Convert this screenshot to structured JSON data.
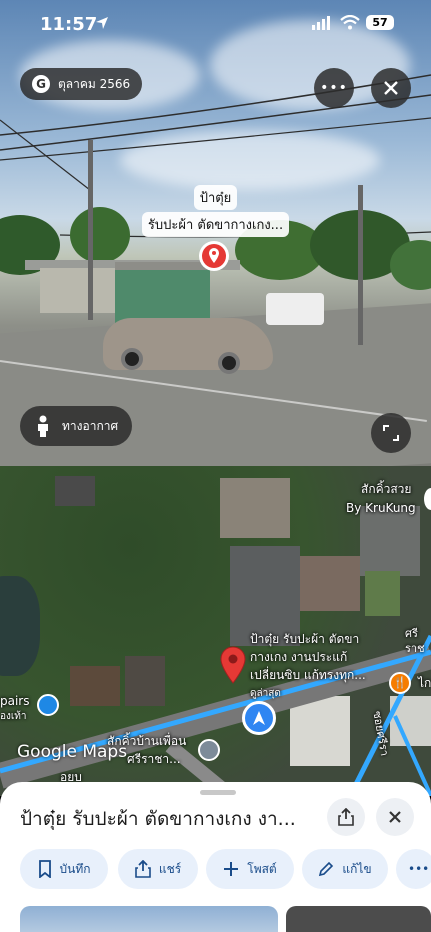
{
  "status_bar": {
    "time": "11:57",
    "battery": "57"
  },
  "street_view": {
    "date_label": "ตุลาคม 2566",
    "place_label_line1": "ป้าตุ๋ย",
    "place_label_line2": "รับปะผ้า ตัดขากางเกง...",
    "aerial_label": "ทางอากาศ"
  },
  "map": {
    "labels": {
      "top_right_1": "สักคิ้วสวย",
      "top_right_2": "By KruKung",
      "place_1": "ป้าตุ๋ย รับปะผ้า ตัดขา",
      "place_2": "กางเกง งานประแก้",
      "place_3": "เปลี่ยนซิบ แก้ทรงทุก...",
      "place_4": "ดูล่าสุด",
      "left_1": "pairs",
      "left_2": "องเท้า",
      "bottom_1": "สักคิ้วบ้านเพื่อน",
      "bottom_2": "ศรีราชา...",
      "road_right": "ศรีราช",
      "road_right_2": "ซอยศรีรา",
      "right_edge": "ไก",
      "road_bottom": "อยบ"
    },
    "google_logo": "Google Maps"
  },
  "sheet": {
    "title": "ป้าตุ๋ย รับปะผ้า ตัดขากางเกง งา...",
    "chips": [
      {
        "label": "บันทึก",
        "icon": "bookmark-icon"
      },
      {
        "label": "แชร์",
        "icon": "share-icon"
      },
      {
        "label": "โพสต์",
        "icon": "plus-icon"
      },
      {
        "label": "แก้ไข",
        "icon": "pencil-icon"
      },
      {
        "label": "•••",
        "icon": "more-icon"
      }
    ]
  },
  "colors": {
    "pin_red": "#e53935",
    "route_blue": "#33a8ff",
    "chip_bg": "#e8f0fb",
    "chip_text": "#1a4c8a"
  }
}
